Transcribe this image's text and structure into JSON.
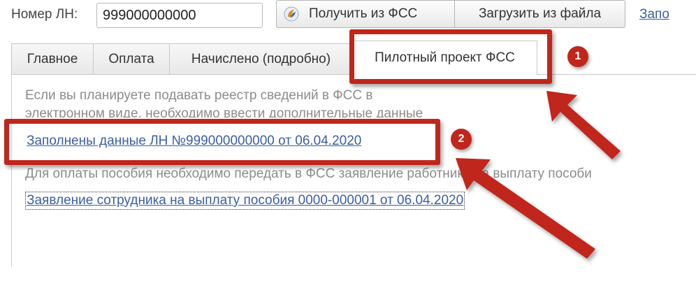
{
  "header": {
    "ln_label": "Номер ЛН:",
    "ln_value": "999000000000",
    "btn_get_fss": "Получить из ФСС",
    "btn_load_file": "Загрузить из файла",
    "link_partial": "Запо"
  },
  "tabs": [
    {
      "label": "Главное",
      "active": false
    },
    {
      "label": "Оплата",
      "active": false
    },
    {
      "label": "Начислено (подробно)",
      "active": false
    },
    {
      "label": "Пилотный проект ФСС",
      "active": true
    }
  ],
  "content": {
    "info_line1": "Если вы планируете подавать реестр сведений в ФСС в",
    "info_line2": "электронном виде, необходимо ввести дополнительные данные",
    "link_ln_data": "Заполнены данные ЛН №999000000000 от 06.04.2020",
    "info_line3": "Для оплаты пособия необходимо передать в ФСС заявление работника на выплату пособи",
    "link_statement": "Заявление сотрудника на выплату пособия 0000-000001 от 06.04.2020"
  },
  "annotations": {
    "badge1": "1",
    "badge2": "2",
    "color": "#c0261b"
  }
}
